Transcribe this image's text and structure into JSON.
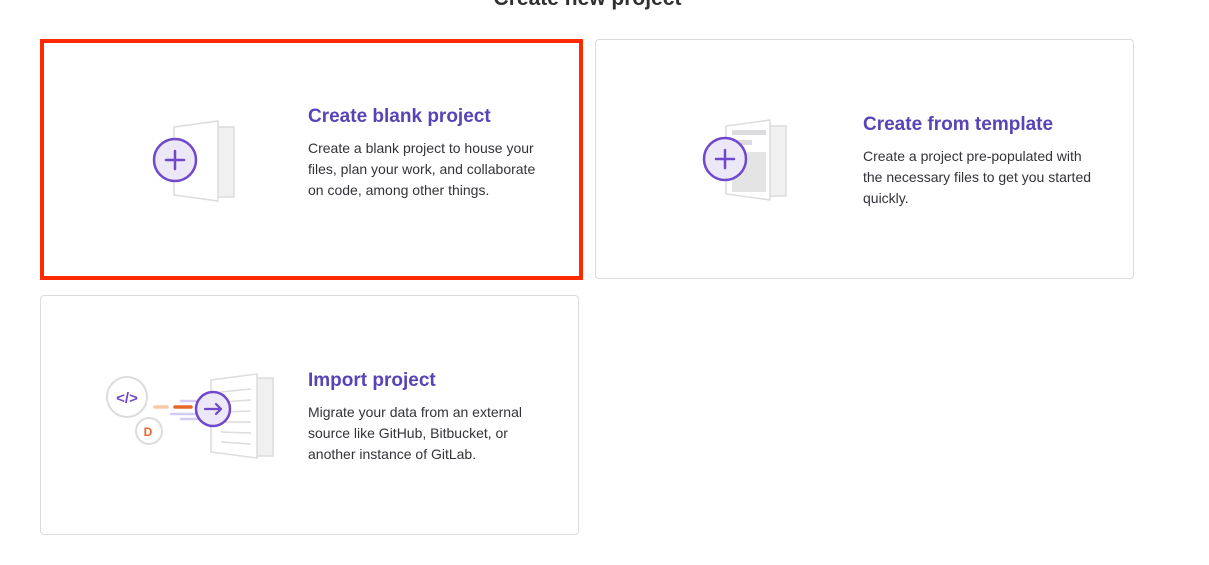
{
  "page": {
    "title": "Create new project"
  },
  "cards": [
    {
      "title": "Create blank project",
      "description": "Create a blank project to house your files, plan your work, and collaborate on code, among other things.",
      "illustration": "blank-project-icon"
    },
    {
      "title": "Create from template",
      "description": "Create a project pre-populated with the necessary files to get you started quickly.",
      "illustration": "template-project-icon"
    },
    {
      "title": "Import project",
      "description": "Migrate your data from an external source like GitHub, Bitbucket, or another instance of GitLab.",
      "illustration": "import-project-icon"
    }
  ],
  "colors": {
    "accent": "#5943b6",
    "highlight": "#ff2a00",
    "border": "#dcdcde",
    "import_orange": "#e8662b"
  }
}
